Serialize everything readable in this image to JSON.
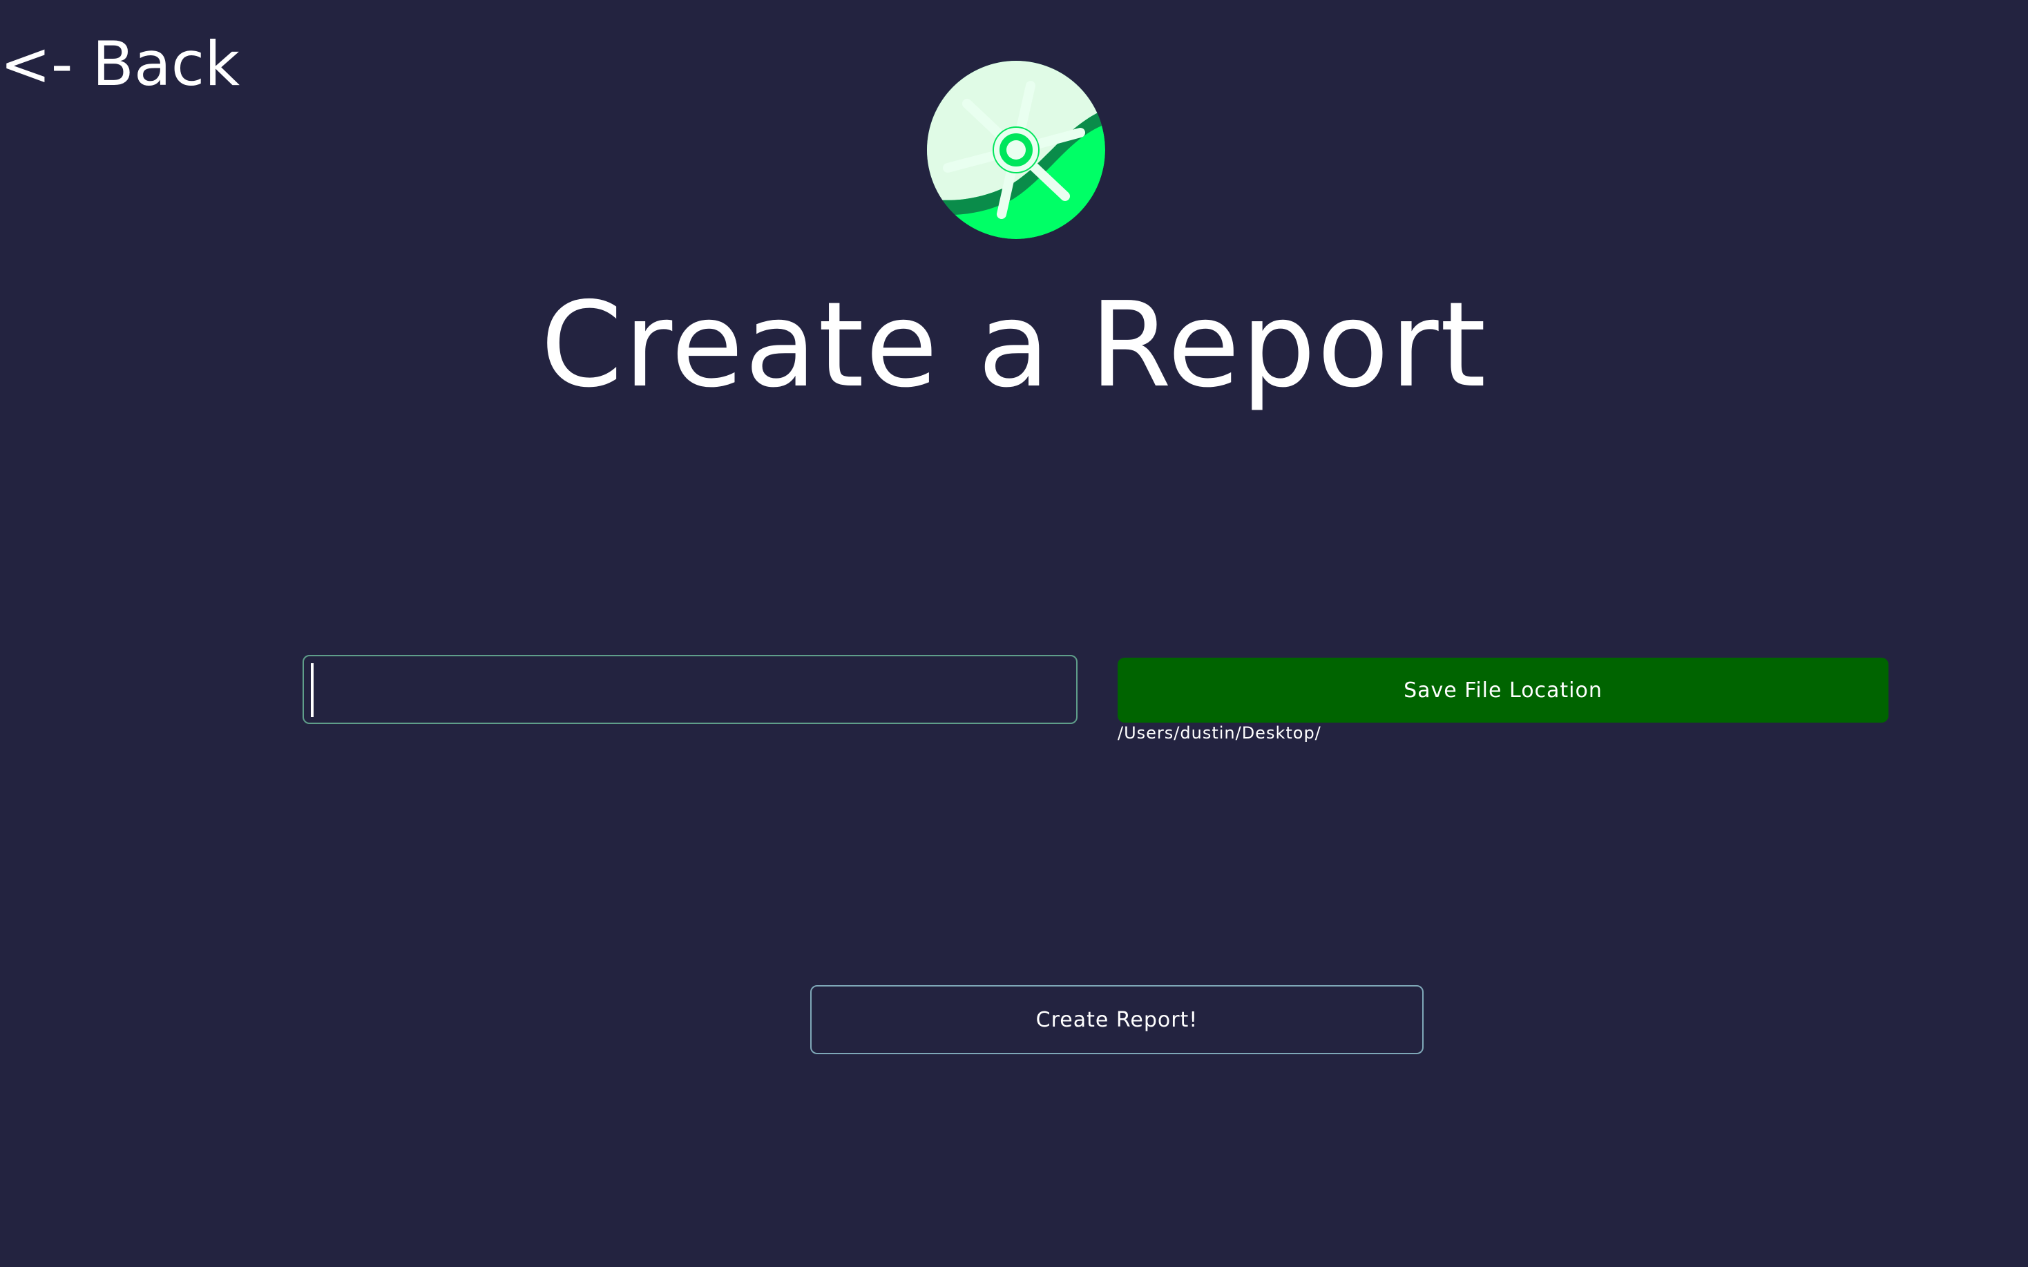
{
  "nav": {
    "back_label": "<- Back"
  },
  "logo": {
    "icon": "ship-wheel-logo-icon",
    "colors": {
      "primary": "#00ff66",
      "light": "#e0fbe6",
      "dark": "#0a8c4a"
    }
  },
  "header": {
    "title": "Create a Report"
  },
  "form": {
    "name_input": {
      "value": "",
      "placeholder": ""
    },
    "save_button_label": "Save File Location",
    "save_path": "/Users/dustin/Desktop/",
    "create_button_label": "Create Report!"
  },
  "colors": {
    "background": "#232340",
    "save_button": "#006400",
    "input_border": "#5f9e8a",
    "create_button_border": "#7fa8b8"
  }
}
